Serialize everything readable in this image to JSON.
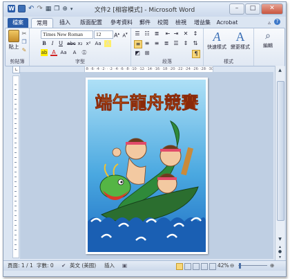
{
  "window": {
    "title": "文件2 [相容模式] - Microsoft Word",
    "buttons": {
      "minimize": "–",
      "maximize": "□",
      "close": "✕"
    }
  },
  "tabs": [
    {
      "label": "檔案"
    },
    {
      "label": "常用"
    },
    {
      "label": "插入"
    },
    {
      "label": "版面配置"
    },
    {
      "label": "參考資料"
    },
    {
      "label": "郵件"
    },
    {
      "label": "校閱"
    },
    {
      "label": "檢視"
    },
    {
      "label": "增益集"
    },
    {
      "label": "Acrobat"
    }
  ],
  "ribbon": {
    "clipboard": {
      "paste_label": "貼上",
      "group_label": "剪貼簿"
    },
    "font": {
      "font_name": "Times New Roman",
      "font_size": "12",
      "group_label": "字型"
    },
    "paragraph": {
      "group_label": "段落"
    },
    "styles": {
      "quick_styles": "快速樣式",
      "change_styles": "變更樣式",
      "group_label": "樣式"
    },
    "editing": {
      "label": "編輯"
    }
  },
  "ruler": {
    "ticks": "·8· ·6· ·4· ·2· · ·2· ·4· ·6· ·8· ·10· ·12· ·14· ·16· ·18· ·20· ·22· ·24· ·26· ·28· ·30· ·32· ·34· ·36· ·38· ·40· ·42· ·44· ·46·"
  },
  "document": {
    "poster_title": "端午龍舟競賽"
  },
  "status": {
    "page": "頁面: 1 / 1",
    "words": "字數: 0",
    "language": "英文 (美國)",
    "mode": "插入",
    "zoom": "42%"
  },
  "colors": {
    "file_tab": "#2a5ca8",
    "poster_title_top": "#ffd23a",
    "poster_title_bottom": "#e0421c",
    "sky_top": "#3b9ed9",
    "water": "#1f6fc4"
  }
}
